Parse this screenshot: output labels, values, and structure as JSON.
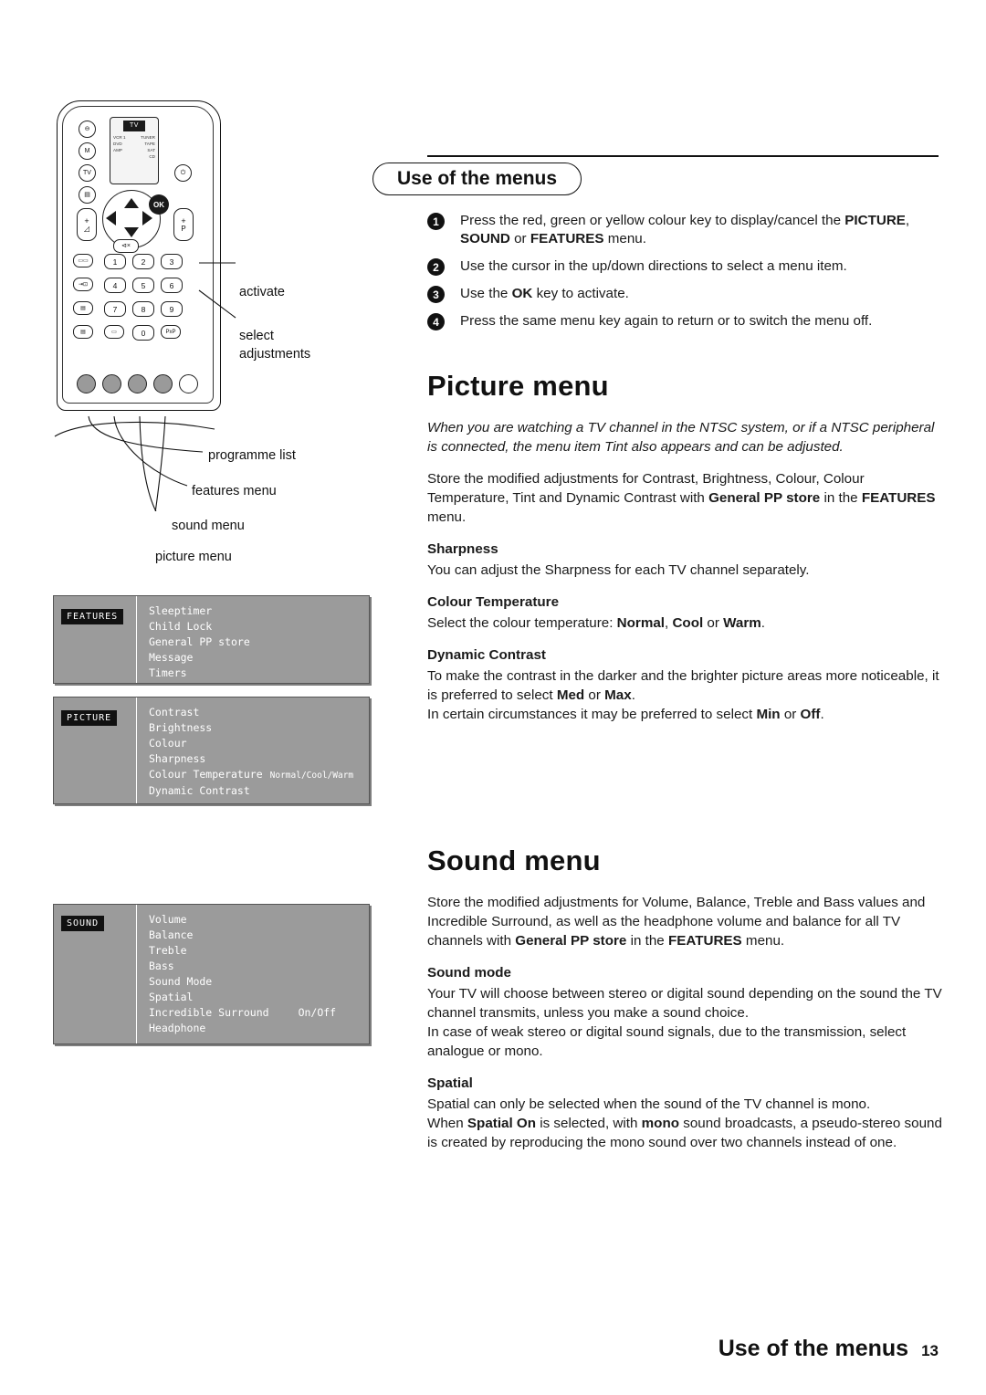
{
  "header": {
    "title": "Use of the menus"
  },
  "steps": [
    {
      "num": "1",
      "html": "Press the red, green or yellow colour key to display/cancel the <b>PICTURE</b>, <b>SOUND</b> or <b>FEATURES</b> menu."
    },
    {
      "num": "2",
      "html": "Use the cursor in the up/down directions to select a menu item."
    },
    {
      "num": "3",
      "html": "Use the <b>OK</b> key to activate."
    },
    {
      "num": "4",
      "html": "Press the same menu key again to return or to switch the menu off."
    }
  ],
  "picture_section": {
    "heading": "Picture menu",
    "italic": "When you are watching a TV channel in the NTSC system, or if a NTSC peripheral is connected, the menu item Tint also appears and can be adjusted.",
    "intro": "Store the modified adjustments for Contrast, Brightness, Colour, Colour Temperature, Tint and Dynamic Contrast with <b>General PP store</b> in the <b>FEATURES</b> menu.",
    "subsections": [
      {
        "title": "Sharpness",
        "body": "You can adjust the Sharpness for each TV channel separately."
      },
      {
        "title": "Colour Temperature",
        "body": "Select the colour temperature: <b>Normal</b>, <b>Cool</b> or <b>Warm</b>."
      },
      {
        "title": "Dynamic Contrast",
        "body": "To make the contrast in the darker and the brighter picture areas more noticeable, it is preferred to select <b>Med</b> or <b>Max</b>.<br>In certain circumstances it may be preferred to select <b>Min</b> or <b>Off</b>."
      }
    ]
  },
  "sound_section": {
    "heading": "Sound menu",
    "intro": "Store the modified adjustments for Volume, Balance, Treble and Bass values and Incredible Surround, as well as the headphone volume and balance for all TV channels with <b>General PP store</b> in the <b>FEATURES</b> menu.",
    "subsections": [
      {
        "title": "Sound mode",
        "body": "Your TV will choose between stereo or digital sound depending on the sound the TV channel transmits, unless you make a sound choice.<br>In case of weak stereo or digital sound signals, due to the transmission, select analogue or mono."
      },
      {
        "title": "Spatial",
        "body": "Spatial can only be selected when the sound of the TV channel is mono.<br>When <b>Spatial On</b> is selected, with <b>mono</b> sound broadcasts, a pseudo-stereo sound is created by reproducing the mono sound over two channels instead of one."
      }
    ]
  },
  "remote": {
    "screen_label": "TV",
    "screen_left": [
      "VCR 1",
      "DVD",
      "AMP"
    ],
    "screen_right": [
      "TUNER",
      "TAPE",
      "SAT",
      "CD"
    ],
    "ok_label": "OK",
    "m_label": "M",
    "tv_label": "TV",
    "p_label": "P",
    "pp_label": "PxP",
    "keys": [
      "1",
      "2",
      "3",
      "4",
      "5",
      "6",
      "7",
      "8",
      "9",
      "0"
    ]
  },
  "callouts": [
    {
      "label": "activate"
    },
    {
      "label": "select"
    },
    {
      "label": "adjustments"
    },
    {
      "label": "programme list"
    },
    {
      "label": "features menu"
    },
    {
      "label": "sound menu"
    },
    {
      "label": "picture menu"
    }
  ],
  "menus": [
    {
      "tab": "FEATURES",
      "items": [
        {
          "name": "Sleeptimer",
          "value": ""
        },
        {
          "name": "Child Lock",
          "value": ""
        },
        {
          "name": "General PP store",
          "value": ""
        },
        {
          "name": "Message",
          "value": ""
        },
        {
          "name": "Timers",
          "value": ""
        }
      ]
    },
    {
      "tab": "PICTURE",
      "items": [
        {
          "name": "Contrast",
          "value": ""
        },
        {
          "name": "Brightness",
          "value": ""
        },
        {
          "name": "Colour",
          "value": ""
        },
        {
          "name": "Sharpness",
          "value": ""
        },
        {
          "name": "Colour Temperature",
          "value": "Normal/Cool/Warm"
        },
        {
          "name": "Dynamic Contrast",
          "value": ""
        }
      ]
    },
    {
      "tab": "SOUND",
      "items": [
        {
          "name": "Volume",
          "value": ""
        },
        {
          "name": "Balance",
          "value": ""
        },
        {
          "name": "Treble",
          "value": ""
        },
        {
          "name": "Bass",
          "value": ""
        },
        {
          "name": "Sound Mode",
          "value": ""
        },
        {
          "name": "Spatial",
          "value": ""
        },
        {
          "name": "Incredible Surround",
          "value": "On/Off"
        },
        {
          "name": "Headphone",
          "value": ""
        }
      ]
    }
  ],
  "footer": {
    "title": "Use of the menus",
    "page": "13"
  }
}
